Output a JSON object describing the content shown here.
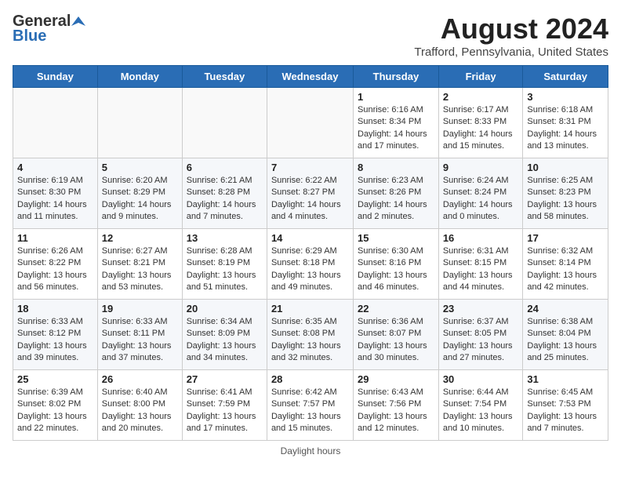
{
  "header": {
    "logo_general": "General",
    "logo_blue": "Blue",
    "month_year": "August 2024",
    "location": "Trafford, Pennsylvania, United States"
  },
  "days_of_week": [
    "Sunday",
    "Monday",
    "Tuesday",
    "Wednesday",
    "Thursday",
    "Friday",
    "Saturday"
  ],
  "footer": {
    "daylight_hours_label": "Daylight hours"
  },
  "weeks": [
    [
      {
        "day": "",
        "info": ""
      },
      {
        "day": "",
        "info": ""
      },
      {
        "day": "",
        "info": ""
      },
      {
        "day": "",
        "info": ""
      },
      {
        "day": "1",
        "info": "Sunrise: 6:16 AM\nSunset: 8:34 PM\nDaylight: 14 hours and 17 minutes."
      },
      {
        "day": "2",
        "info": "Sunrise: 6:17 AM\nSunset: 8:33 PM\nDaylight: 14 hours and 15 minutes."
      },
      {
        "day": "3",
        "info": "Sunrise: 6:18 AM\nSunset: 8:31 PM\nDaylight: 14 hours and 13 minutes."
      }
    ],
    [
      {
        "day": "4",
        "info": "Sunrise: 6:19 AM\nSunset: 8:30 PM\nDaylight: 14 hours and 11 minutes."
      },
      {
        "day": "5",
        "info": "Sunrise: 6:20 AM\nSunset: 8:29 PM\nDaylight: 14 hours and 9 minutes."
      },
      {
        "day": "6",
        "info": "Sunrise: 6:21 AM\nSunset: 8:28 PM\nDaylight: 14 hours and 7 minutes."
      },
      {
        "day": "7",
        "info": "Sunrise: 6:22 AM\nSunset: 8:27 PM\nDaylight: 14 hours and 4 minutes."
      },
      {
        "day": "8",
        "info": "Sunrise: 6:23 AM\nSunset: 8:26 PM\nDaylight: 14 hours and 2 minutes."
      },
      {
        "day": "9",
        "info": "Sunrise: 6:24 AM\nSunset: 8:24 PM\nDaylight: 14 hours and 0 minutes."
      },
      {
        "day": "10",
        "info": "Sunrise: 6:25 AM\nSunset: 8:23 PM\nDaylight: 13 hours and 58 minutes."
      }
    ],
    [
      {
        "day": "11",
        "info": "Sunrise: 6:26 AM\nSunset: 8:22 PM\nDaylight: 13 hours and 56 minutes."
      },
      {
        "day": "12",
        "info": "Sunrise: 6:27 AM\nSunset: 8:21 PM\nDaylight: 13 hours and 53 minutes."
      },
      {
        "day": "13",
        "info": "Sunrise: 6:28 AM\nSunset: 8:19 PM\nDaylight: 13 hours and 51 minutes."
      },
      {
        "day": "14",
        "info": "Sunrise: 6:29 AM\nSunset: 8:18 PM\nDaylight: 13 hours and 49 minutes."
      },
      {
        "day": "15",
        "info": "Sunrise: 6:30 AM\nSunset: 8:16 PM\nDaylight: 13 hours and 46 minutes."
      },
      {
        "day": "16",
        "info": "Sunrise: 6:31 AM\nSunset: 8:15 PM\nDaylight: 13 hours and 44 minutes."
      },
      {
        "day": "17",
        "info": "Sunrise: 6:32 AM\nSunset: 8:14 PM\nDaylight: 13 hours and 42 minutes."
      }
    ],
    [
      {
        "day": "18",
        "info": "Sunrise: 6:33 AM\nSunset: 8:12 PM\nDaylight: 13 hours and 39 minutes."
      },
      {
        "day": "19",
        "info": "Sunrise: 6:33 AM\nSunset: 8:11 PM\nDaylight: 13 hours and 37 minutes."
      },
      {
        "day": "20",
        "info": "Sunrise: 6:34 AM\nSunset: 8:09 PM\nDaylight: 13 hours and 34 minutes."
      },
      {
        "day": "21",
        "info": "Sunrise: 6:35 AM\nSunset: 8:08 PM\nDaylight: 13 hours and 32 minutes."
      },
      {
        "day": "22",
        "info": "Sunrise: 6:36 AM\nSunset: 8:07 PM\nDaylight: 13 hours and 30 minutes."
      },
      {
        "day": "23",
        "info": "Sunrise: 6:37 AM\nSunset: 8:05 PM\nDaylight: 13 hours and 27 minutes."
      },
      {
        "day": "24",
        "info": "Sunrise: 6:38 AM\nSunset: 8:04 PM\nDaylight: 13 hours and 25 minutes."
      }
    ],
    [
      {
        "day": "25",
        "info": "Sunrise: 6:39 AM\nSunset: 8:02 PM\nDaylight: 13 hours and 22 minutes."
      },
      {
        "day": "26",
        "info": "Sunrise: 6:40 AM\nSunset: 8:00 PM\nDaylight: 13 hours and 20 minutes."
      },
      {
        "day": "27",
        "info": "Sunrise: 6:41 AM\nSunset: 7:59 PM\nDaylight: 13 hours and 17 minutes."
      },
      {
        "day": "28",
        "info": "Sunrise: 6:42 AM\nSunset: 7:57 PM\nDaylight: 13 hours and 15 minutes."
      },
      {
        "day": "29",
        "info": "Sunrise: 6:43 AM\nSunset: 7:56 PM\nDaylight: 13 hours and 12 minutes."
      },
      {
        "day": "30",
        "info": "Sunrise: 6:44 AM\nSunset: 7:54 PM\nDaylight: 13 hours and 10 minutes."
      },
      {
        "day": "31",
        "info": "Sunrise: 6:45 AM\nSunset: 7:53 PM\nDaylight: 13 hours and 7 minutes."
      }
    ]
  ]
}
